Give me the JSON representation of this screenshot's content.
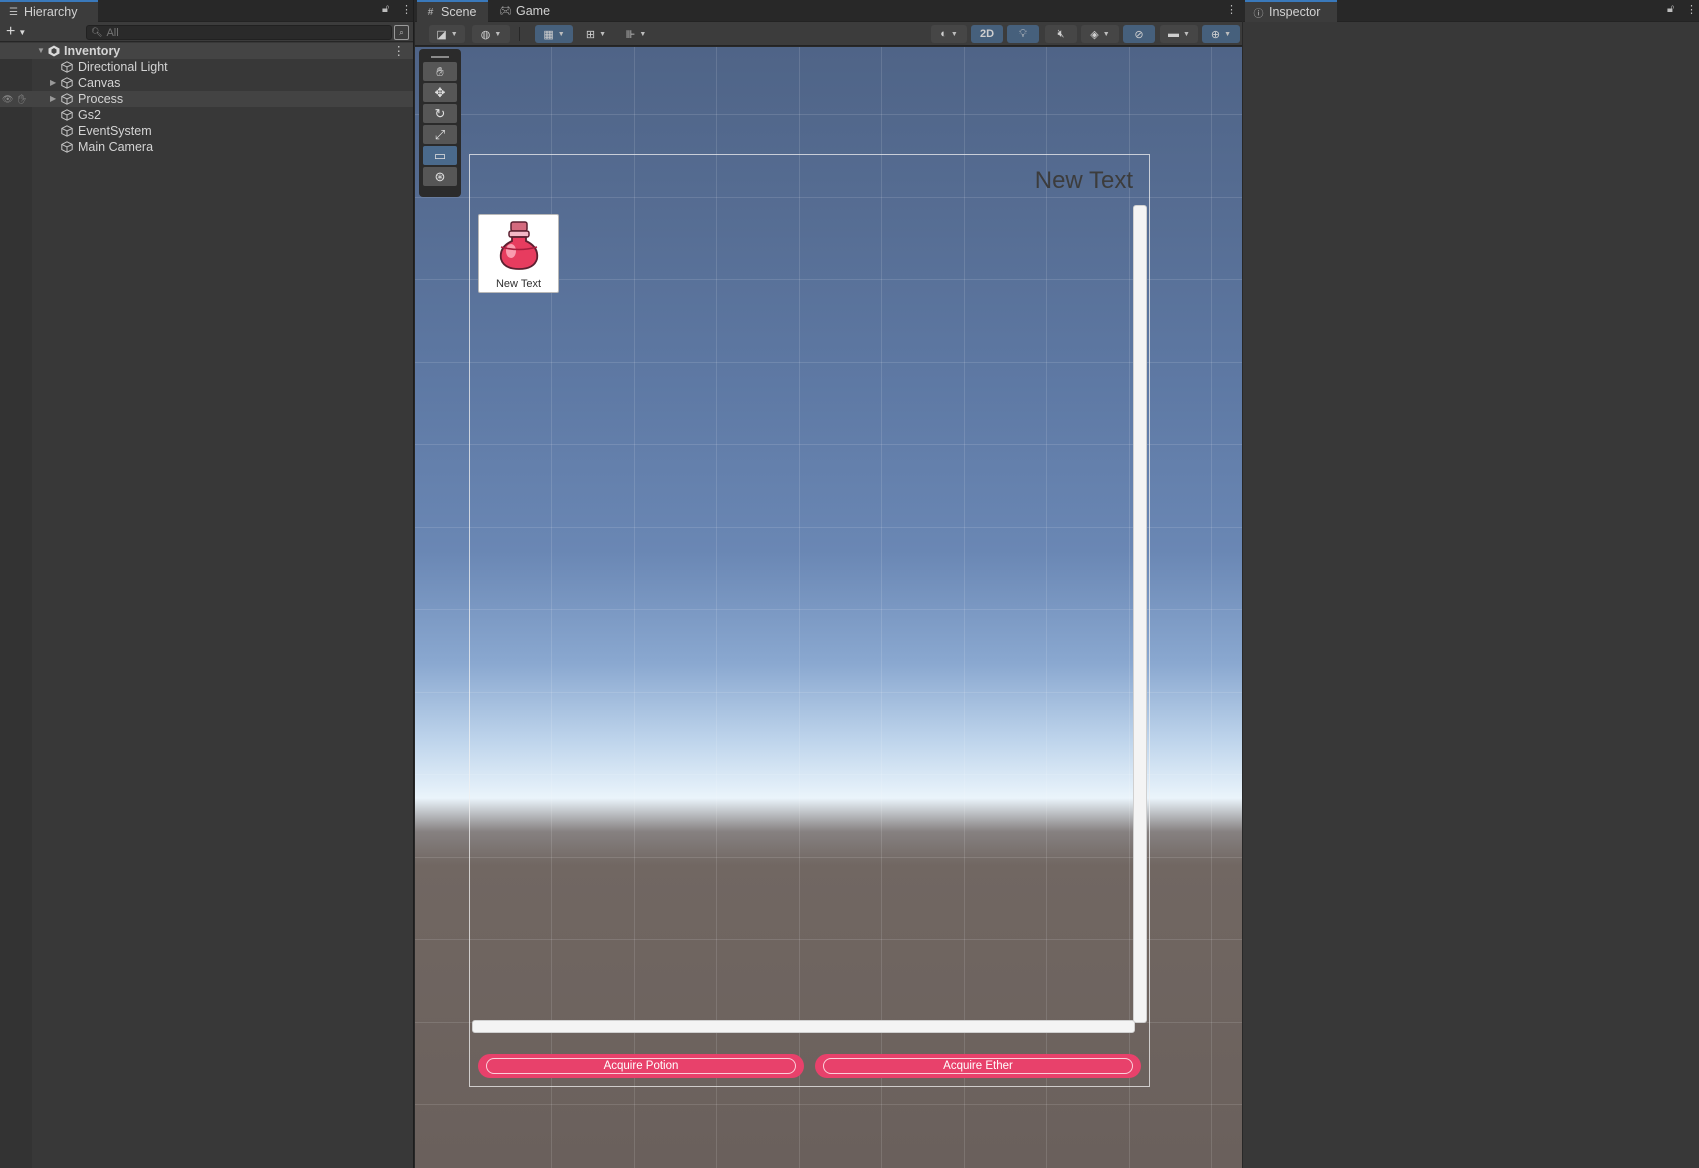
{
  "hierarchy": {
    "tab_label": "Hierarchy",
    "search_placeholder": "All",
    "scene_name": "Inventory",
    "objects": [
      {
        "label": "Directional Light",
        "foldable": false
      },
      {
        "label": "Canvas",
        "foldable": true
      },
      {
        "label": "Process",
        "foldable": true
      },
      {
        "label": "Gs2",
        "foldable": false
      },
      {
        "label": "EventSystem",
        "foldable": false
      },
      {
        "label": "Main Camera",
        "foldable": false
      }
    ]
  },
  "scene_view": {
    "tabs": [
      {
        "label": "Scene",
        "icon": "scene-grid-icon",
        "active": true
      },
      {
        "label": "Game",
        "icon": "gamepad-icon",
        "active": false
      }
    ],
    "mode_2d_label": "2D",
    "tools": [
      "hand-tool-icon",
      "move-tool-icon",
      "rotate-tool-icon",
      "scale-tool-icon",
      "rect-tool-icon",
      "transform-tool-icon"
    ],
    "active_tool": "rect-tool-icon"
  },
  "canvas_ui": {
    "title_text": "New Text",
    "item_label": "New Text",
    "item_icon": "potion-icon",
    "buttons": [
      "Acquire Potion",
      "Acquire Ether"
    ],
    "button_color": "#e8416b"
  },
  "inspector": {
    "tab_label": "Inspector"
  }
}
